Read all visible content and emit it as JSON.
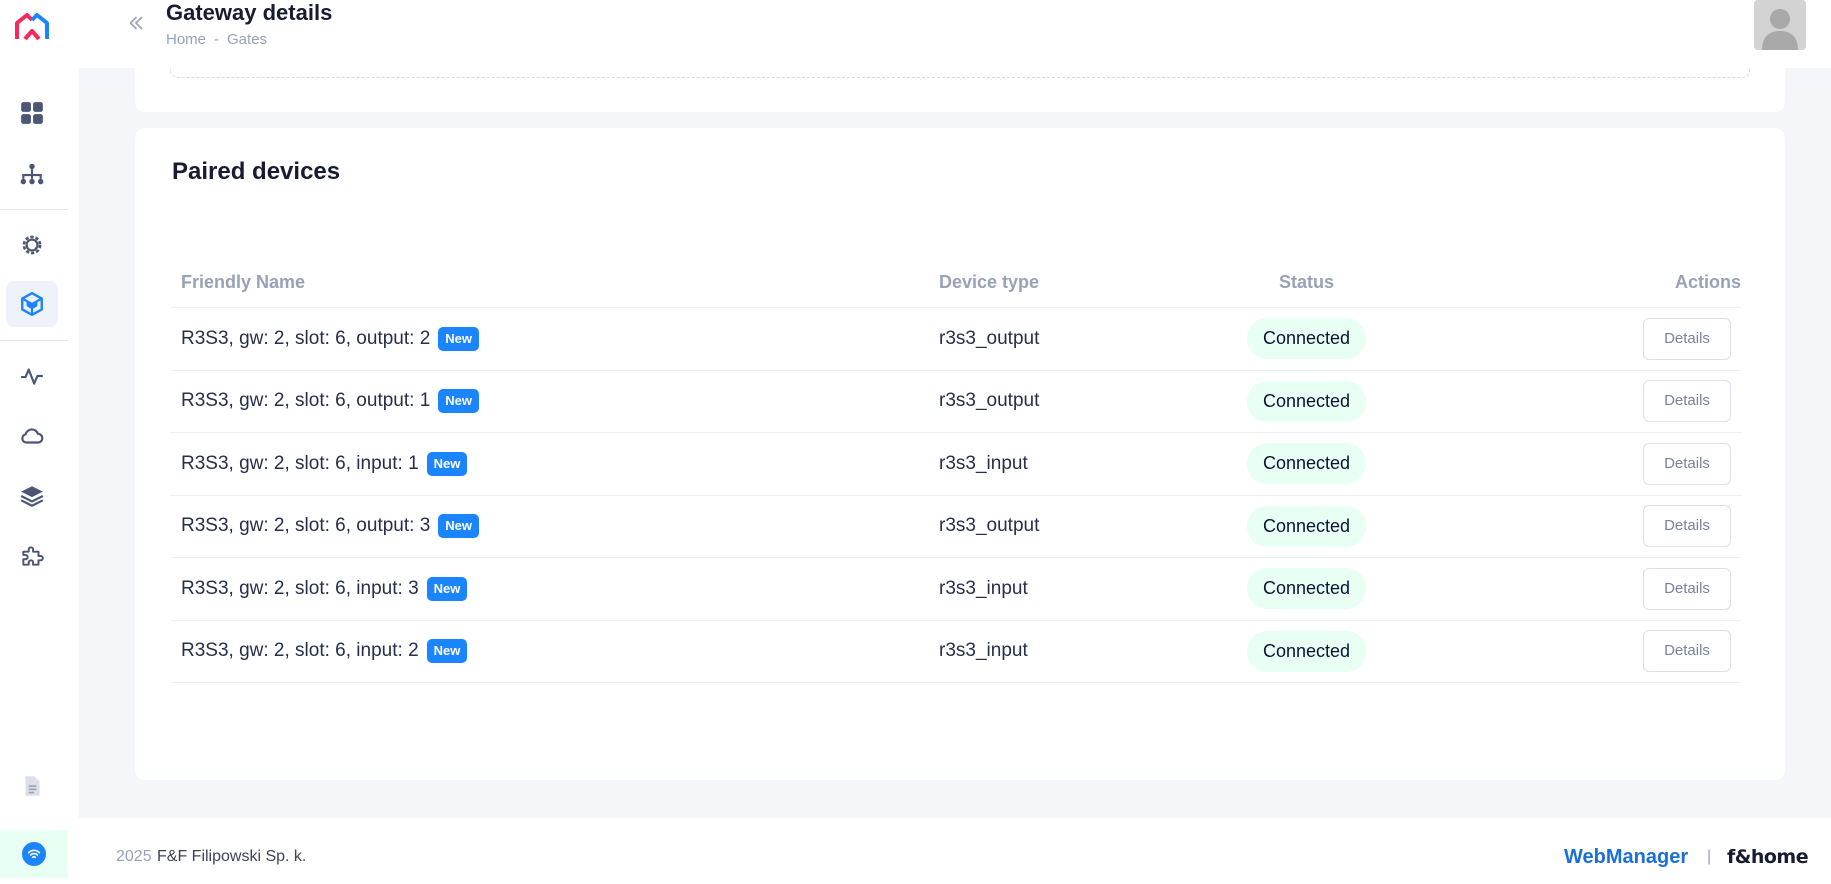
{
  "header": {
    "title": "Gateway details",
    "breadcrumb": [
      "Home",
      "Gates"
    ],
    "breadcrumb_sep": "-"
  },
  "sidebar": {
    "items": [
      {
        "icon": "dashboard-icon"
      },
      {
        "icon": "network-icon"
      },
      {
        "icon": "settings-icon"
      },
      {
        "icon": "cube-icon",
        "active": true
      },
      {
        "icon": "activity-icon"
      },
      {
        "icon": "cloud-icon"
      },
      {
        "icon": "layers-icon"
      },
      {
        "icon": "puzzle-icon"
      },
      {
        "icon": "document-icon"
      },
      {
        "icon": "wifi-icon"
      }
    ]
  },
  "devices": {
    "title": "Paired devices",
    "columns": {
      "name": "Friendly Name",
      "type": "Device type",
      "status": "Status",
      "actions": "Actions"
    },
    "rows": [
      {
        "name": "R3S3, gw: 2, slot: 6, output: 2",
        "badge": "New",
        "type": "r3s3_output",
        "status": "Connected",
        "action": "Details"
      },
      {
        "name": "R3S3, gw: 2, slot: 6, output: 1",
        "badge": "New",
        "type": "r3s3_output",
        "status": "Connected",
        "action": "Details"
      },
      {
        "name": "R3S3, gw: 2, slot: 6, input: 1",
        "badge": "New",
        "type": "r3s3_input",
        "status": "Connected",
        "action": "Details"
      },
      {
        "name": "R3S3, gw: 2, slot: 6, output: 3",
        "badge": "New",
        "type": "r3s3_output",
        "status": "Connected",
        "action": "Details"
      },
      {
        "name": "R3S3, gw: 2, slot: 6, input: 3",
        "badge": "New",
        "type": "r3s3_input",
        "status": "Connected",
        "action": "Details"
      },
      {
        "name": "R3S3, gw: 2, slot: 6, input: 2",
        "badge": "New",
        "type": "r3s3_input",
        "status": "Connected",
        "action": "Details"
      }
    ]
  },
  "footer": {
    "year": "2025",
    "company": "F&F Filipowski Sp. k.",
    "app_name": "WebManager",
    "separator": "|",
    "brand": "f&home"
  },
  "colors": {
    "accent": "#1b84ff",
    "status_bg": "#e8fff3",
    "logo_left": "#f8285a",
    "logo_right": "#1b84ff"
  }
}
